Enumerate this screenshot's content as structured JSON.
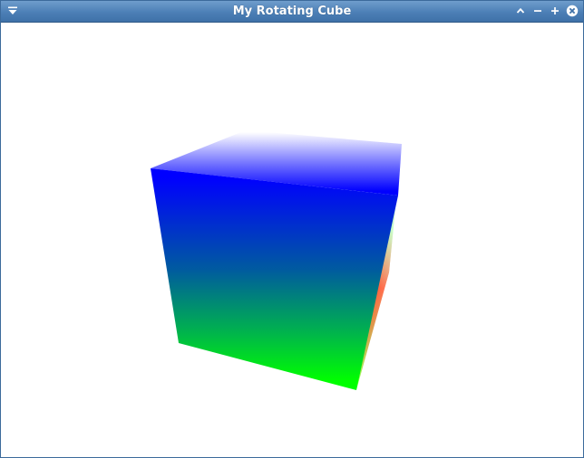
{
  "window": {
    "title": "My Rotating Cube"
  },
  "titlebar": {
    "menu_icon": "chevron-menu-icon",
    "controls": [
      {
        "name": "shade",
        "icon": "caret-up-icon"
      },
      {
        "name": "minimize",
        "icon": "minus-icon"
      },
      {
        "name": "maximize",
        "icon": "plus-icon"
      },
      {
        "name": "close",
        "icon": "close-circle-icon"
      }
    ]
  },
  "scene": {
    "object": "cube",
    "colors": {
      "top": "#0000ff",
      "bottom": "#00ff00",
      "side": "#ff0000",
      "highlight": "#ffffff"
    }
  }
}
